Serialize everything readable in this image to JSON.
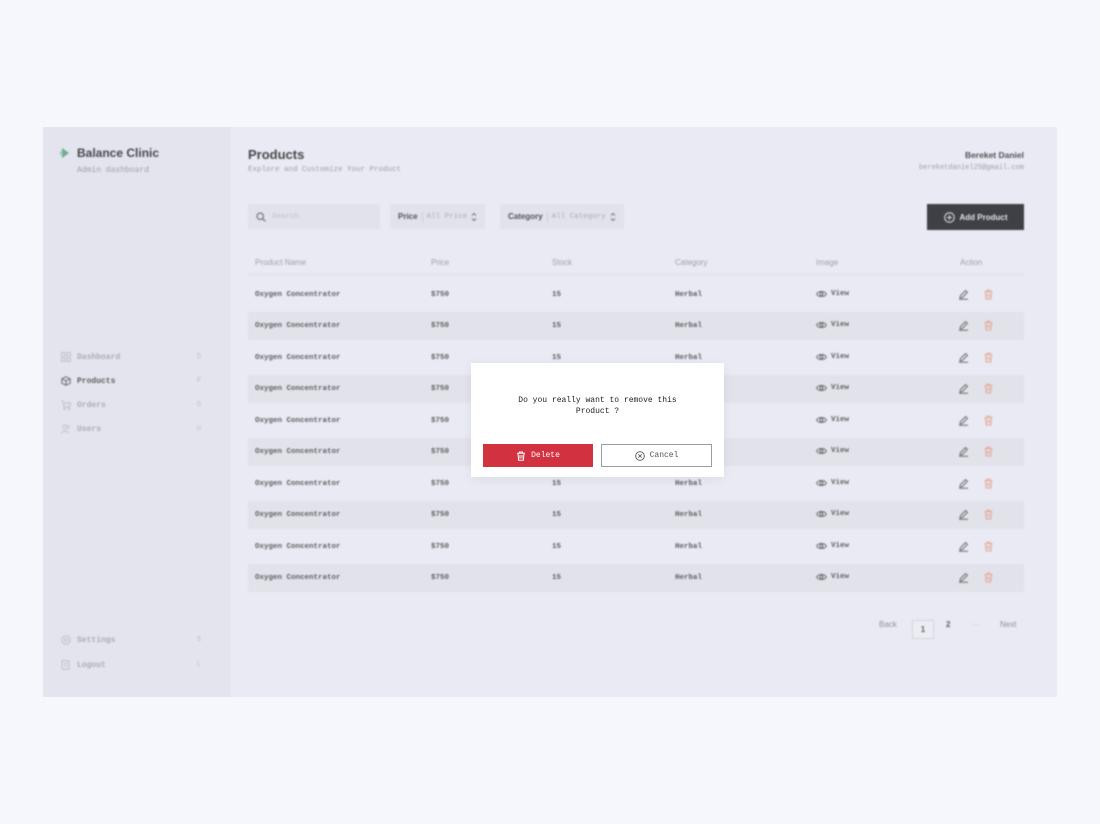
{
  "sidebar": {
    "brand_name": "Balance Clinic",
    "brand_sub": "Admin dashboard",
    "items": [
      {
        "label": "Dashboard",
        "key": "D",
        "icon": "grid-icon"
      },
      {
        "label": "Products",
        "key": "P",
        "icon": "box-icon",
        "active": true
      },
      {
        "label": "Orders",
        "key": "O",
        "icon": "cart-icon"
      },
      {
        "label": "Users",
        "key": "U",
        "icon": "users-icon"
      }
    ],
    "bottom_items": [
      {
        "label": "Settings",
        "key": "S",
        "icon": "gear-icon"
      },
      {
        "label": "Logout",
        "key": "L",
        "icon": "logout-icon"
      }
    ]
  },
  "header": {
    "title": "Products",
    "subtitle": "Explore and Customize Your Product",
    "user_name": "Bereket Daniel",
    "user_email": "bereketdaniel25@gmail.com"
  },
  "toolbar": {
    "search_placeholder": "Search",
    "price_label": "Price",
    "price_value": "All Price",
    "category_label": "Category",
    "category_value": "All Category",
    "add_label": "Add Product"
  },
  "table": {
    "columns": [
      "Product Name",
      "Price",
      "Stock",
      "Category",
      "Image",
      "Action"
    ],
    "view_label": "View",
    "rows": [
      {
        "name": "Oxygen Concentrator",
        "price": "$750",
        "stock": "15",
        "category": "Herbal"
      },
      {
        "name": "Oxygen Concentrator",
        "price": "$750",
        "stock": "15",
        "category": "Herbal"
      },
      {
        "name": "Oxygen Concentrator",
        "price": "$750",
        "stock": "15",
        "category": "Herbal"
      },
      {
        "name": "Oxygen Concentrator",
        "price": "$750",
        "stock": "15",
        "category": "Herbal"
      },
      {
        "name": "Oxygen Concentrator",
        "price": "$750",
        "stock": "15",
        "category": "Herbal"
      },
      {
        "name": "Oxygen Concentrator",
        "price": "$750",
        "stock": "15",
        "category": "Herbal"
      },
      {
        "name": "Oxygen Concentrator",
        "price": "$750",
        "stock": "15",
        "category": "Herbal"
      },
      {
        "name": "Oxygen Concentrator",
        "price": "$750",
        "stock": "15",
        "category": "Herbal"
      },
      {
        "name": "Oxygen Concentrator",
        "price": "$750",
        "stock": "15",
        "category": "Herbal"
      },
      {
        "name": "Oxygen Concentrator",
        "price": "$750",
        "stock": "15",
        "category": "Herbal"
      }
    ]
  },
  "pagination": {
    "back": "Back",
    "pages": [
      "1",
      "2"
    ],
    "ellipsis": "···",
    "next": "Next",
    "current": "1"
  },
  "modal": {
    "message": "Do you really want to remove this Product ?",
    "delete_label": "Delete",
    "cancel_label": "Cancel"
  },
  "colors": {
    "delete": "#d2323f",
    "trash_icon": "#e8957a",
    "add_button": "#0b0c10"
  }
}
